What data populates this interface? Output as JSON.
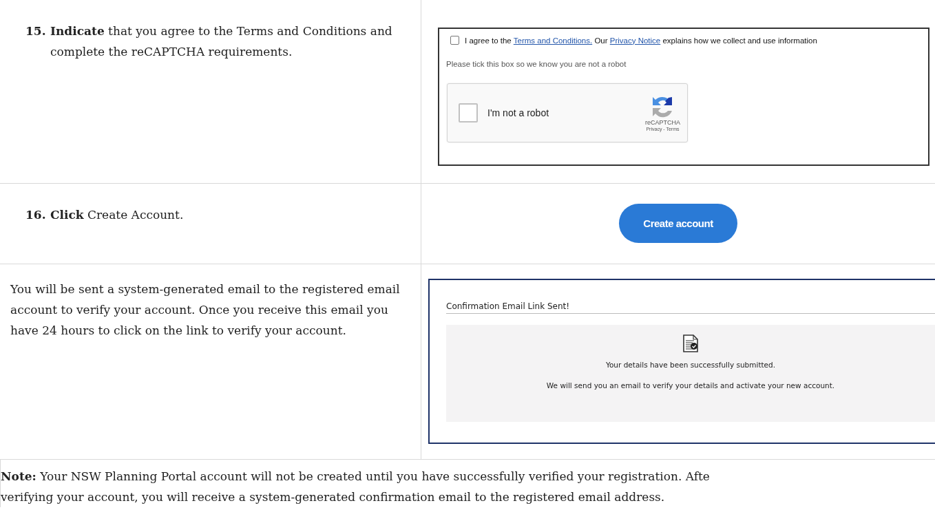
{
  "rows": [
    {
      "kind": "step",
      "number": "15.",
      "text": "**Indicate** that you agree to the Terms and Conditions and complete the reCAPTCHA requirements.",
      "panel": {
        "kind": "agree",
        "terms_checkbox": {
          "checked": false
        },
        "agree_before": "I agree to the",
        "terms_link": "Terms and Conditions.",
        "agree_middle": "Our",
        "privacy_link": "Privacy Notice",
        "agree_after": "explains how we collect and use information",
        "hint": "Please tick this box so we know you are not a robot",
        "captcha": {
          "checked": false,
          "label": "I'm not a robot",
          "brand": "reCAPTCHA",
          "links": "Privacy - Terms"
        }
      }
    },
    {
      "kind": "step",
      "number": "16.",
      "text": "**Click** Create Account.",
      "panel": {
        "kind": "button",
        "label": "Create account"
      }
    },
    {
      "kind": "plain",
      "text": "You will be sent a system-generated email to the registered email account to verify your account. Once you receive this email you have 24 hours to click on the link to verify your account.",
      "panel": {
        "kind": "confirm",
        "title": "Confirmation Email Link Sent!",
        "message": "Your details have been successfully submitted.",
        "detail": "We will send you an email to verify your details and activate your new account."
      }
    }
  ],
  "note": "**Note:** Your NSW Planning Portal account will not be created until you have successfully verified your registration. Afte\nverifying your account, you will receive a system-generated confirmation email to the registered email address."
}
